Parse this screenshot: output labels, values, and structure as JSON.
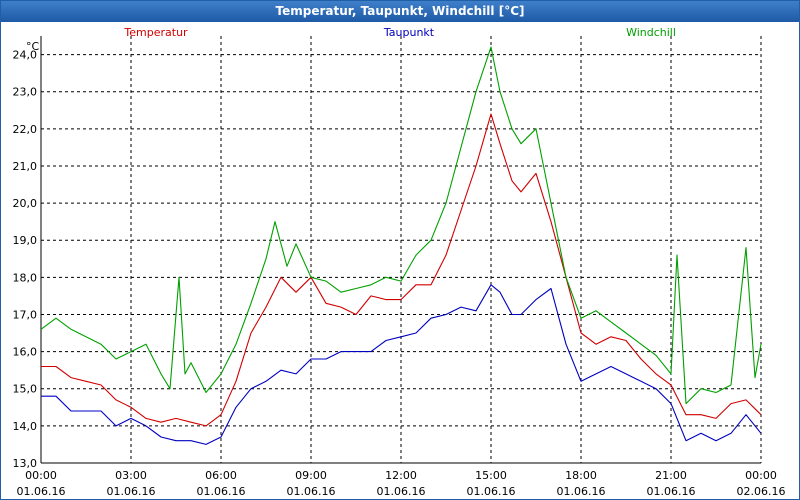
{
  "window": {
    "title": "Temperatur, Taupunkt, Windchill [°C]"
  },
  "chart_data": {
    "type": "line",
    "title": "Temperatur, Taupunkt, Windchill [°C]",
    "ylabel": "°C",
    "xlabel": "",
    "ylim": [
      13.0,
      24.5
    ],
    "xlim": [
      0,
      24
    ],
    "grid": true,
    "y_ticks": [
      "13,0",
      "14,0",
      "15,0",
      "16,0",
      "17,0",
      "18,0",
      "19,0",
      "20,0",
      "21,0",
      "22,0",
      "23,0",
      "24,0"
    ],
    "x_ticks": [
      {
        "time": "00:00",
        "date": "01.06.16",
        "h": 0
      },
      {
        "time": "03:00",
        "date": "01.06.16",
        "h": 3
      },
      {
        "time": "06:00",
        "date": "01.06.16",
        "h": 6
      },
      {
        "time": "09:00",
        "date": "01.06.16",
        "h": 9
      },
      {
        "time": "12:00",
        "date": "01.06.16",
        "h": 12
      },
      {
        "time": "15:00",
        "date": "01.06.16",
        "h": 15
      },
      {
        "time": "18:00",
        "date": "01.06.16",
        "h": 18
      },
      {
        "time": "21:00",
        "date": "01.06.16",
        "h": 21
      },
      {
        "time": "00:00",
        "date": "02.06.16",
        "h": 24
      }
    ],
    "series": [
      {
        "name": "Temperatur",
        "color": "#d00000",
        "x": [
          0,
          0.5,
          1,
          1.5,
          2,
          2.5,
          3,
          3.5,
          4,
          4.5,
          5,
          5.5,
          6,
          6.5,
          7,
          7.5,
          8,
          8.5,
          9,
          9.5,
          10,
          10.5,
          11,
          11.5,
          12,
          12.5,
          13,
          13.5,
          14,
          14.5,
          15,
          15.3,
          15.7,
          16,
          16.5,
          17,
          17.5,
          18,
          18.5,
          19,
          19.5,
          20,
          20.5,
          21,
          21.5,
          22,
          22.5,
          23,
          23.5,
          24
        ],
        "values": [
          15.6,
          15.6,
          15.3,
          15.2,
          15.1,
          14.7,
          14.5,
          14.2,
          14.1,
          14.2,
          14.1,
          14.0,
          14.3,
          15.2,
          16.5,
          17.2,
          18.0,
          17.6,
          18.0,
          17.3,
          17.2,
          17.0,
          17.5,
          17.4,
          17.4,
          17.8,
          17.8,
          18.6,
          19.8,
          21.0,
          22.4,
          21.6,
          20.6,
          20.3,
          20.8,
          19.5,
          18.0,
          16.5,
          16.2,
          16.4,
          16.3,
          15.8,
          15.4,
          15.1,
          14.3,
          14.3,
          14.2,
          14.6,
          14.7,
          14.3
        ],
        "legend_label": "Temperatur"
      },
      {
        "name": "Taupunkt",
        "color": "#0000c0",
        "x": [
          0,
          0.5,
          1,
          1.5,
          2,
          2.5,
          3,
          3.5,
          4,
          4.5,
          5,
          5.5,
          6,
          6.5,
          7,
          7.5,
          8,
          8.5,
          9,
          9.5,
          10,
          10.5,
          11,
          11.5,
          12,
          12.5,
          13,
          13.5,
          14,
          14.5,
          15,
          15.3,
          15.7,
          16,
          16.5,
          17,
          17.5,
          18,
          18.5,
          19,
          19.5,
          20,
          20.5,
          21,
          21.5,
          22,
          22.5,
          23,
          23.5,
          24
        ],
        "values": [
          14.8,
          14.8,
          14.4,
          14.4,
          14.4,
          14.0,
          14.2,
          14.0,
          13.7,
          13.6,
          13.6,
          13.5,
          13.7,
          14.5,
          15.0,
          15.2,
          15.5,
          15.4,
          15.8,
          15.8,
          16.0,
          16.0,
          16.0,
          16.3,
          16.4,
          16.5,
          16.9,
          17.0,
          17.2,
          17.1,
          17.8,
          17.6,
          17.0,
          17.0,
          17.4,
          17.7,
          16.2,
          15.2,
          15.4,
          15.6,
          15.4,
          15.2,
          15.0,
          14.6,
          13.6,
          13.8,
          13.6,
          13.8,
          14.3,
          13.8
        ],
        "legend_label": "Taupunkt"
      },
      {
        "name": "Windchill",
        "color": "#00a000",
        "x": [
          0,
          0.5,
          1,
          1.5,
          2,
          2.5,
          3,
          3.5,
          4,
          4.3,
          4.6,
          4.8,
          5,
          5.5,
          6,
          6.5,
          7,
          7.5,
          7.8,
          8.2,
          8.5,
          9,
          9.5,
          10,
          10.5,
          11,
          11.5,
          12,
          12.5,
          13,
          13.5,
          14,
          14.5,
          15,
          15.3,
          15.7,
          16,
          16.5,
          17,
          17.5,
          18,
          18.5,
          19,
          19.5,
          20,
          20.5,
          21,
          21.2,
          21.5,
          22,
          22.5,
          23,
          23.5,
          23.8,
          24
        ],
        "values": [
          16.6,
          16.9,
          16.6,
          16.4,
          16.2,
          15.8,
          16.0,
          16.2,
          15.4,
          15.0,
          18.0,
          15.4,
          15.7,
          14.9,
          15.4,
          16.2,
          17.3,
          18.5,
          19.5,
          18.3,
          18.9,
          18.0,
          17.9,
          17.6,
          17.7,
          17.8,
          18.0,
          17.9,
          18.6,
          19.0,
          20.0,
          21.5,
          23.0,
          24.2,
          23.0,
          22.0,
          21.6,
          22.0,
          20.0,
          18.0,
          16.9,
          17.1,
          16.8,
          16.5,
          16.2,
          15.9,
          15.4,
          18.6,
          14.6,
          15.0,
          14.9,
          15.1,
          18.8,
          15.3,
          16.2
        ],
        "legend_label": "Windchill"
      }
    ]
  }
}
